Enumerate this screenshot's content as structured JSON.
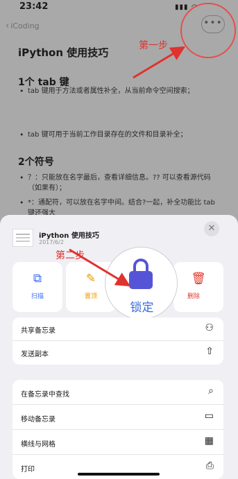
{
  "status_bar": {
    "time": "23:42",
    "icons": "signal-wifi"
  },
  "nav": {
    "back_label": "iCoding",
    "more_icon": "ellipsis-icon"
  },
  "annotations": {
    "step1": "第一步",
    "step2": "第二步"
  },
  "note": {
    "title": "iPython 使用技巧",
    "section1_heading": "1个 tab 键",
    "section1_bullets": [
      "tab 键用于方法或者属性补全，从当前命令空间搜索；",
      "tab 键可用于当前工作目录存在的文件和目录补全；"
    ],
    "section2_heading": "2个符号",
    "section2_bullets": [
      "？：只能放在名字最后，查看详细信息。?? 可以查看源代码（如果有）；",
      "*：通配符，可以放在名字中间。结合?一起，补全功能比 tab 键还强大"
    ]
  },
  "share_sheet": {
    "note_title": "iPython 使用技巧",
    "note_date": "2017/6/2",
    "close_icon": "close-icon",
    "actions": [
      {
        "icon": "scan-icon",
        "label": "扫描"
      },
      {
        "icon": "pin-icon",
        "label": "置顶"
      },
      {
        "icon": "lock-icon",
        "label": "锁定"
      },
      {
        "icon": "trash-icon",
        "label": "删除"
      }
    ],
    "group1": [
      {
        "label": "共享备忘录",
        "icon": "add-person-icon"
      },
      {
        "label": "发送副本",
        "icon": "share-icon"
      }
    ],
    "group2": [
      {
        "label": "在备忘录中查找",
        "icon": "search-icon"
      },
      {
        "label": "移动备忘录",
        "icon": "folder-icon"
      },
      {
        "label": "横线与网格",
        "icon": "grid-icon"
      },
      {
        "label": "打印",
        "icon": "print-icon"
      }
    ]
  },
  "colors": {
    "annotation_red": "#e0322f",
    "lock_purple": "#5654d6",
    "lock_label_blue": "#3a6bd8",
    "pin_orange": "#e69a00",
    "delete_red": "#e03a2f",
    "scan_blue": "#3b6ef5"
  }
}
